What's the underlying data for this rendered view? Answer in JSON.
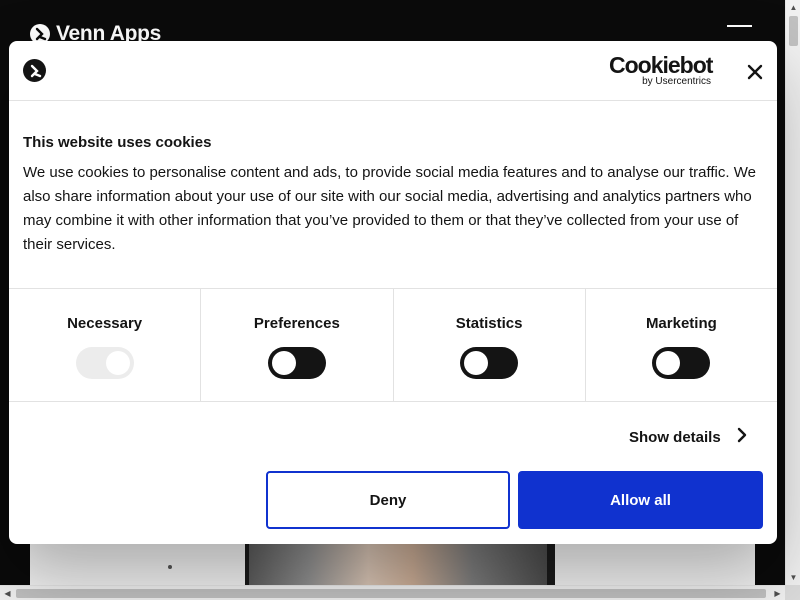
{
  "site": {
    "brand_name": "Venn Apps",
    "menu_icon": "hamburger-menu-icon"
  },
  "dialog": {
    "provider_name": "Cookiebot",
    "provider_sub": "by Usercentrics",
    "title": "This website uses cookies",
    "body": "We use cookies to personalise content and ads, to provide social media features and to analyse our traffic. We also share information about your use of our site with our social media, advertising and analytics partners who may combine it with other information that you’ve provided to them or that they’ve collected from your use of their services.",
    "categories": [
      {
        "label": "Necessary",
        "enabled": true,
        "locked": true
      },
      {
        "label": "Preferences",
        "enabled": false,
        "locked": false
      },
      {
        "label": "Statistics",
        "enabled": false,
        "locked": false
      },
      {
        "label": "Marketing",
        "enabled": false,
        "locked": false
      }
    ],
    "show_details_label": "Show details",
    "deny_label": "Deny",
    "allow_all_label": "Allow all",
    "colors": {
      "accent": "#1032cf",
      "toggle_off": "#141414",
      "toggle_disabled": "#ececec"
    }
  }
}
